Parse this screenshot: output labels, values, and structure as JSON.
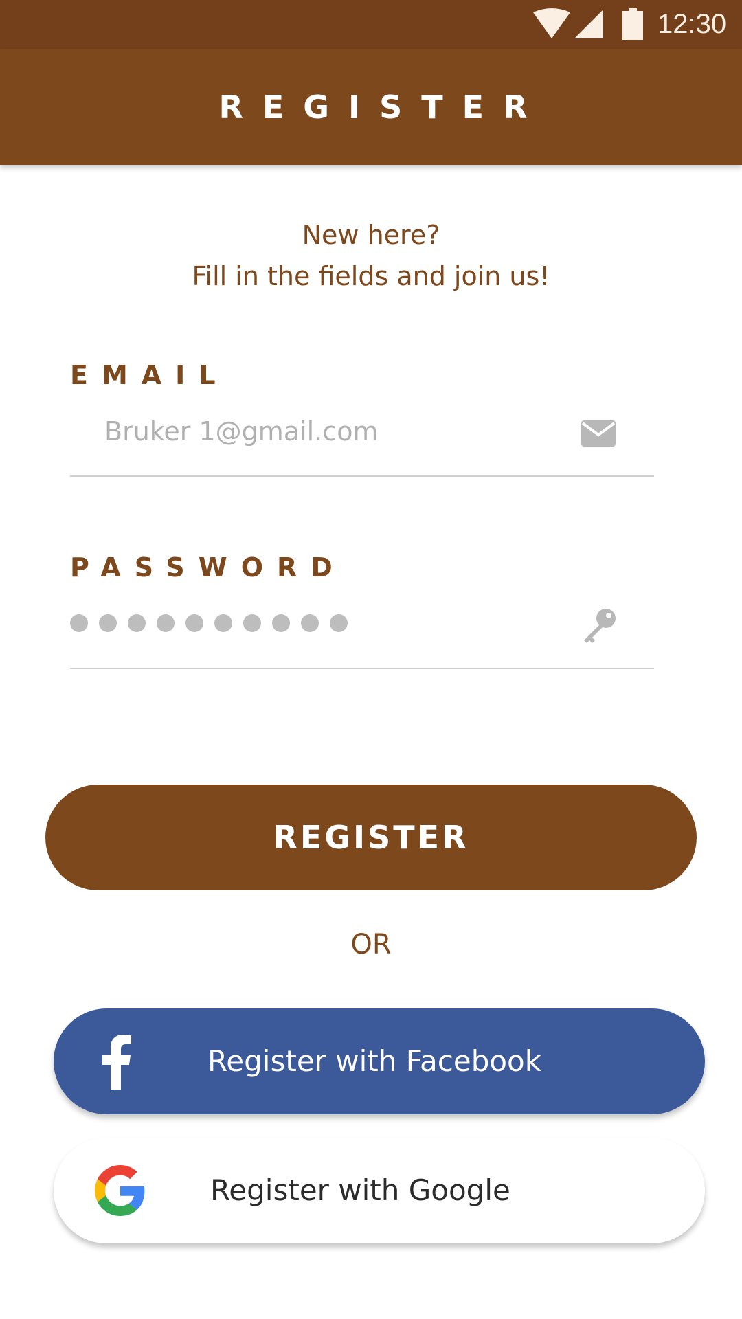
{
  "status_bar": {
    "time": "12:30",
    "wifi_icon": "wifi-icon",
    "signal_icon": "cell-signal-icon",
    "battery_icon": "battery-icon"
  },
  "app_bar": {
    "title": "REGISTER"
  },
  "intro": {
    "line1": "New here?",
    "line2": "Fill in the fields and join us!"
  },
  "email": {
    "label": "EMAIL",
    "value": "Bruker 1@gmail.com",
    "icon": "envelope-icon"
  },
  "password": {
    "label": "PASSWORD",
    "masked_length": 10,
    "icon": "key-icon"
  },
  "register_button": {
    "label": "REGISTER"
  },
  "divider_text": "OR",
  "facebook_button": {
    "label": "Register with Facebook",
    "icon": "facebook-icon"
  },
  "google_button": {
    "label": "Register with Google",
    "icon": "google-icon"
  },
  "colors": {
    "status_bar": "#74401b",
    "primary": "#7e481d",
    "facebook": "#3c5a99",
    "hint": "#b0b0b0"
  }
}
